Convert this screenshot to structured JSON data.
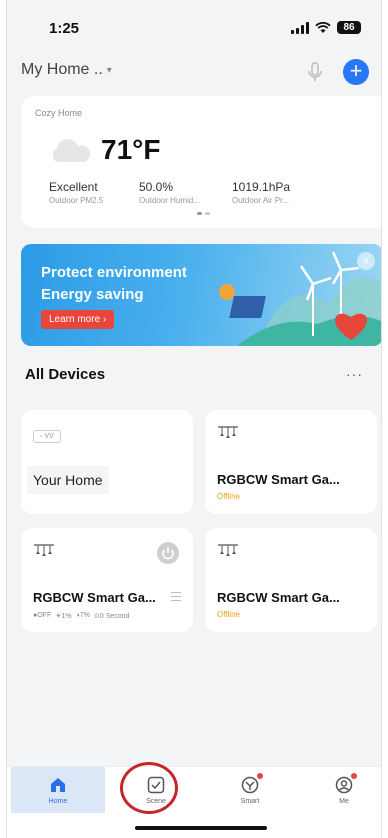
{
  "status": {
    "time": "1:25",
    "battery": "86"
  },
  "header": {
    "home_name": "My Home ..",
    "caret": "▾",
    "add_label": "+"
  },
  "weather": {
    "place": "Cozy Home",
    "temperature": "71°F",
    "stats": [
      {
        "value": "Excellent",
        "label": "Outdoor PM2.5"
      },
      {
        "value": "50.0%",
        "label": "Outdoor Humid..."
      },
      {
        "value": "1019.1hPa",
        "label": "Outdoor Air Pr..."
      }
    ]
  },
  "banner": {
    "line1": "Protect environment",
    "line2": "Energy saving",
    "button": "Learn more ›",
    "close": "×"
  },
  "devices_section": {
    "title": "All Devices",
    "more": "···"
  },
  "devices": [
    {
      "badge": "◦ VV",
      "name": "Your Home"
    },
    {
      "name": "RGBCW Smart Ga...",
      "status": "Offline"
    },
    {
      "name": "RGBCW Smart Ga...",
      "stats": [
        "●OFF",
        "☀1%",
        "◑7%",
        "⊙0 Second"
      ]
    },
    {
      "name": "RGBCW Smart Ga...",
      "status": "Offline"
    }
  ],
  "tabs": [
    {
      "label": "Home",
      "icon": "home-icon"
    },
    {
      "label": "Scene",
      "icon": "scene-check-icon"
    },
    {
      "label": "Smart",
      "icon": "smart-icon"
    },
    {
      "label": "Me",
      "icon": "profile-icon"
    }
  ],
  "colors": {
    "accent": "#2877f5",
    "offline": "#f0a020",
    "highlight": "#c4262a"
  }
}
